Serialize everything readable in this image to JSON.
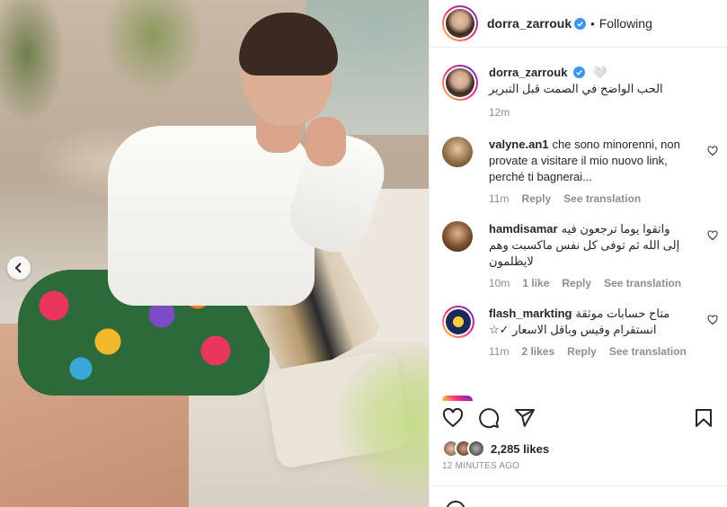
{
  "post": {
    "username": "dorra_zarrouk",
    "follow_state": "Following",
    "caption_emoji": "🤍",
    "caption": "الحب الواضح في الصمت قبل التبرير",
    "caption_time": "12m"
  },
  "comments": [
    {
      "username": "valyne.an1",
      "text": "che sono minorenni, non provate a visitare il mio nuovo link, perché ti bagnerai...",
      "time": "11m",
      "reply": "Reply",
      "translate": "See translation",
      "likes": ""
    },
    {
      "username": "hamdisamar",
      "text": "واتقوا يوما ترجعون فيه إلى الله ثم توفى كل نفس ماكسبت وهم لايظلمون",
      "time": "10m",
      "likes": "1 like",
      "reply": "Reply",
      "translate": "See translation"
    },
    {
      "username": "flash_markting",
      "text": "متاح حسابات موثقة انستقرام وفيس وباقل الاسعار ✓☆",
      "time": "11m",
      "likes": "2 likes",
      "reply": "Reply",
      "translate": "See translation"
    }
  ],
  "likes": {
    "count_label": "2,285 likes"
  },
  "timestamp": "12 MINUTES AGO",
  "icons": [
    "chevron-left-icon",
    "verified-icon",
    "heart-icon",
    "comment-icon",
    "share-icon",
    "bookmark-icon",
    "emoji-icon"
  ],
  "colors": {
    "verified": "#3897f0",
    "meta": "#8e8e8e",
    "text": "#262626"
  }
}
